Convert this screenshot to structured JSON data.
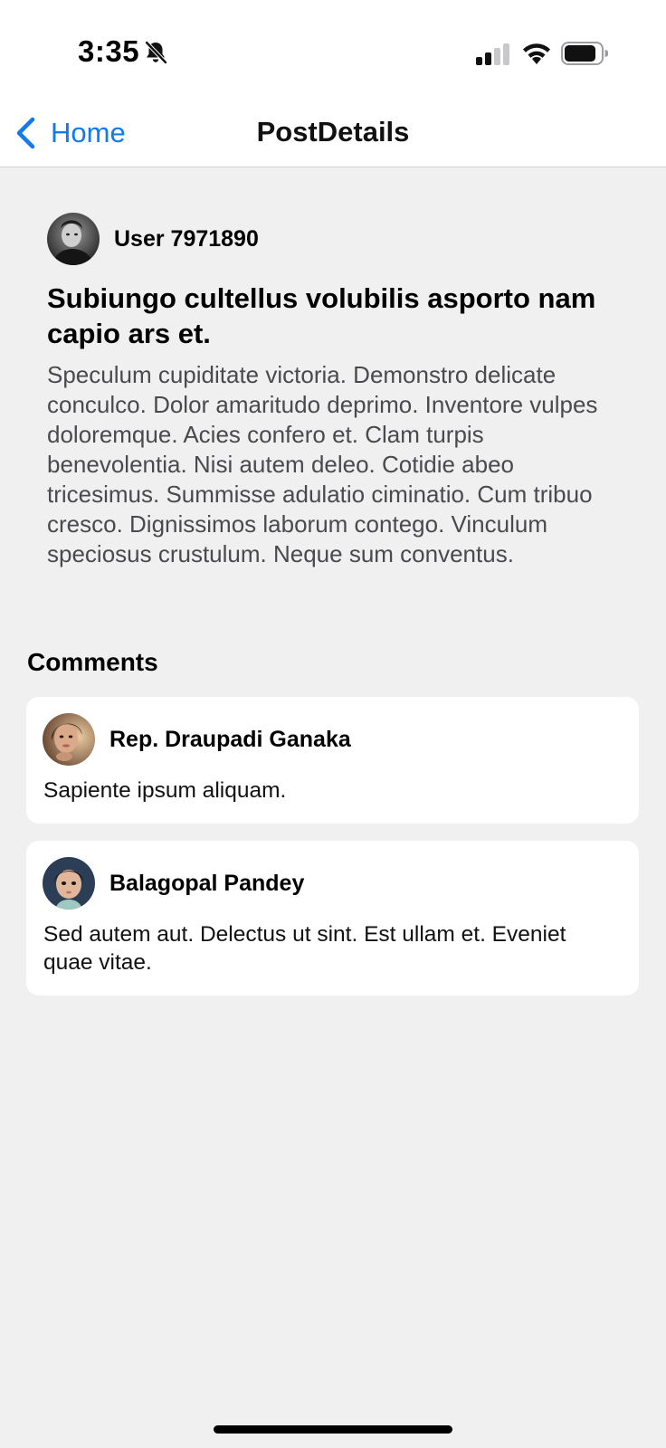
{
  "status_bar": {
    "time": "3:35",
    "icons": [
      "bell-slash-icon",
      "cellular-signal-icon",
      "wifi-icon",
      "battery-icon"
    ]
  },
  "nav": {
    "back_label": "Home",
    "title": "PostDetails",
    "accent_color": "#1279ee"
  },
  "post": {
    "author": "User 7971890",
    "title": "Subiungo cultellus volubilis asporto nam capio ars et.",
    "body": "Speculum cupiditate victoria. Demonstro delicate conculco. Dolor amaritudo deprimo. Inventore vulpes doloremque. Acies confero et. Clam turpis benevolentia. Nisi autem deleo. Cotidie abeo tricesimus. Summisse adulatio ciminatio. Cum tribuo cresco. Dignissimos laborum contego. Vinculum speciosus crustulum. Neque sum conventus."
  },
  "comments": {
    "heading": "Comments",
    "items": [
      {
        "author": "Rep. Draupadi Ganaka",
        "text": "Sapiente ipsum aliquam."
      },
      {
        "author": "Balagopal Pandey",
        "text": "Sed autem aut. Delectus ut sint. Est ullam et. Eveniet quae vitae."
      }
    ]
  }
}
